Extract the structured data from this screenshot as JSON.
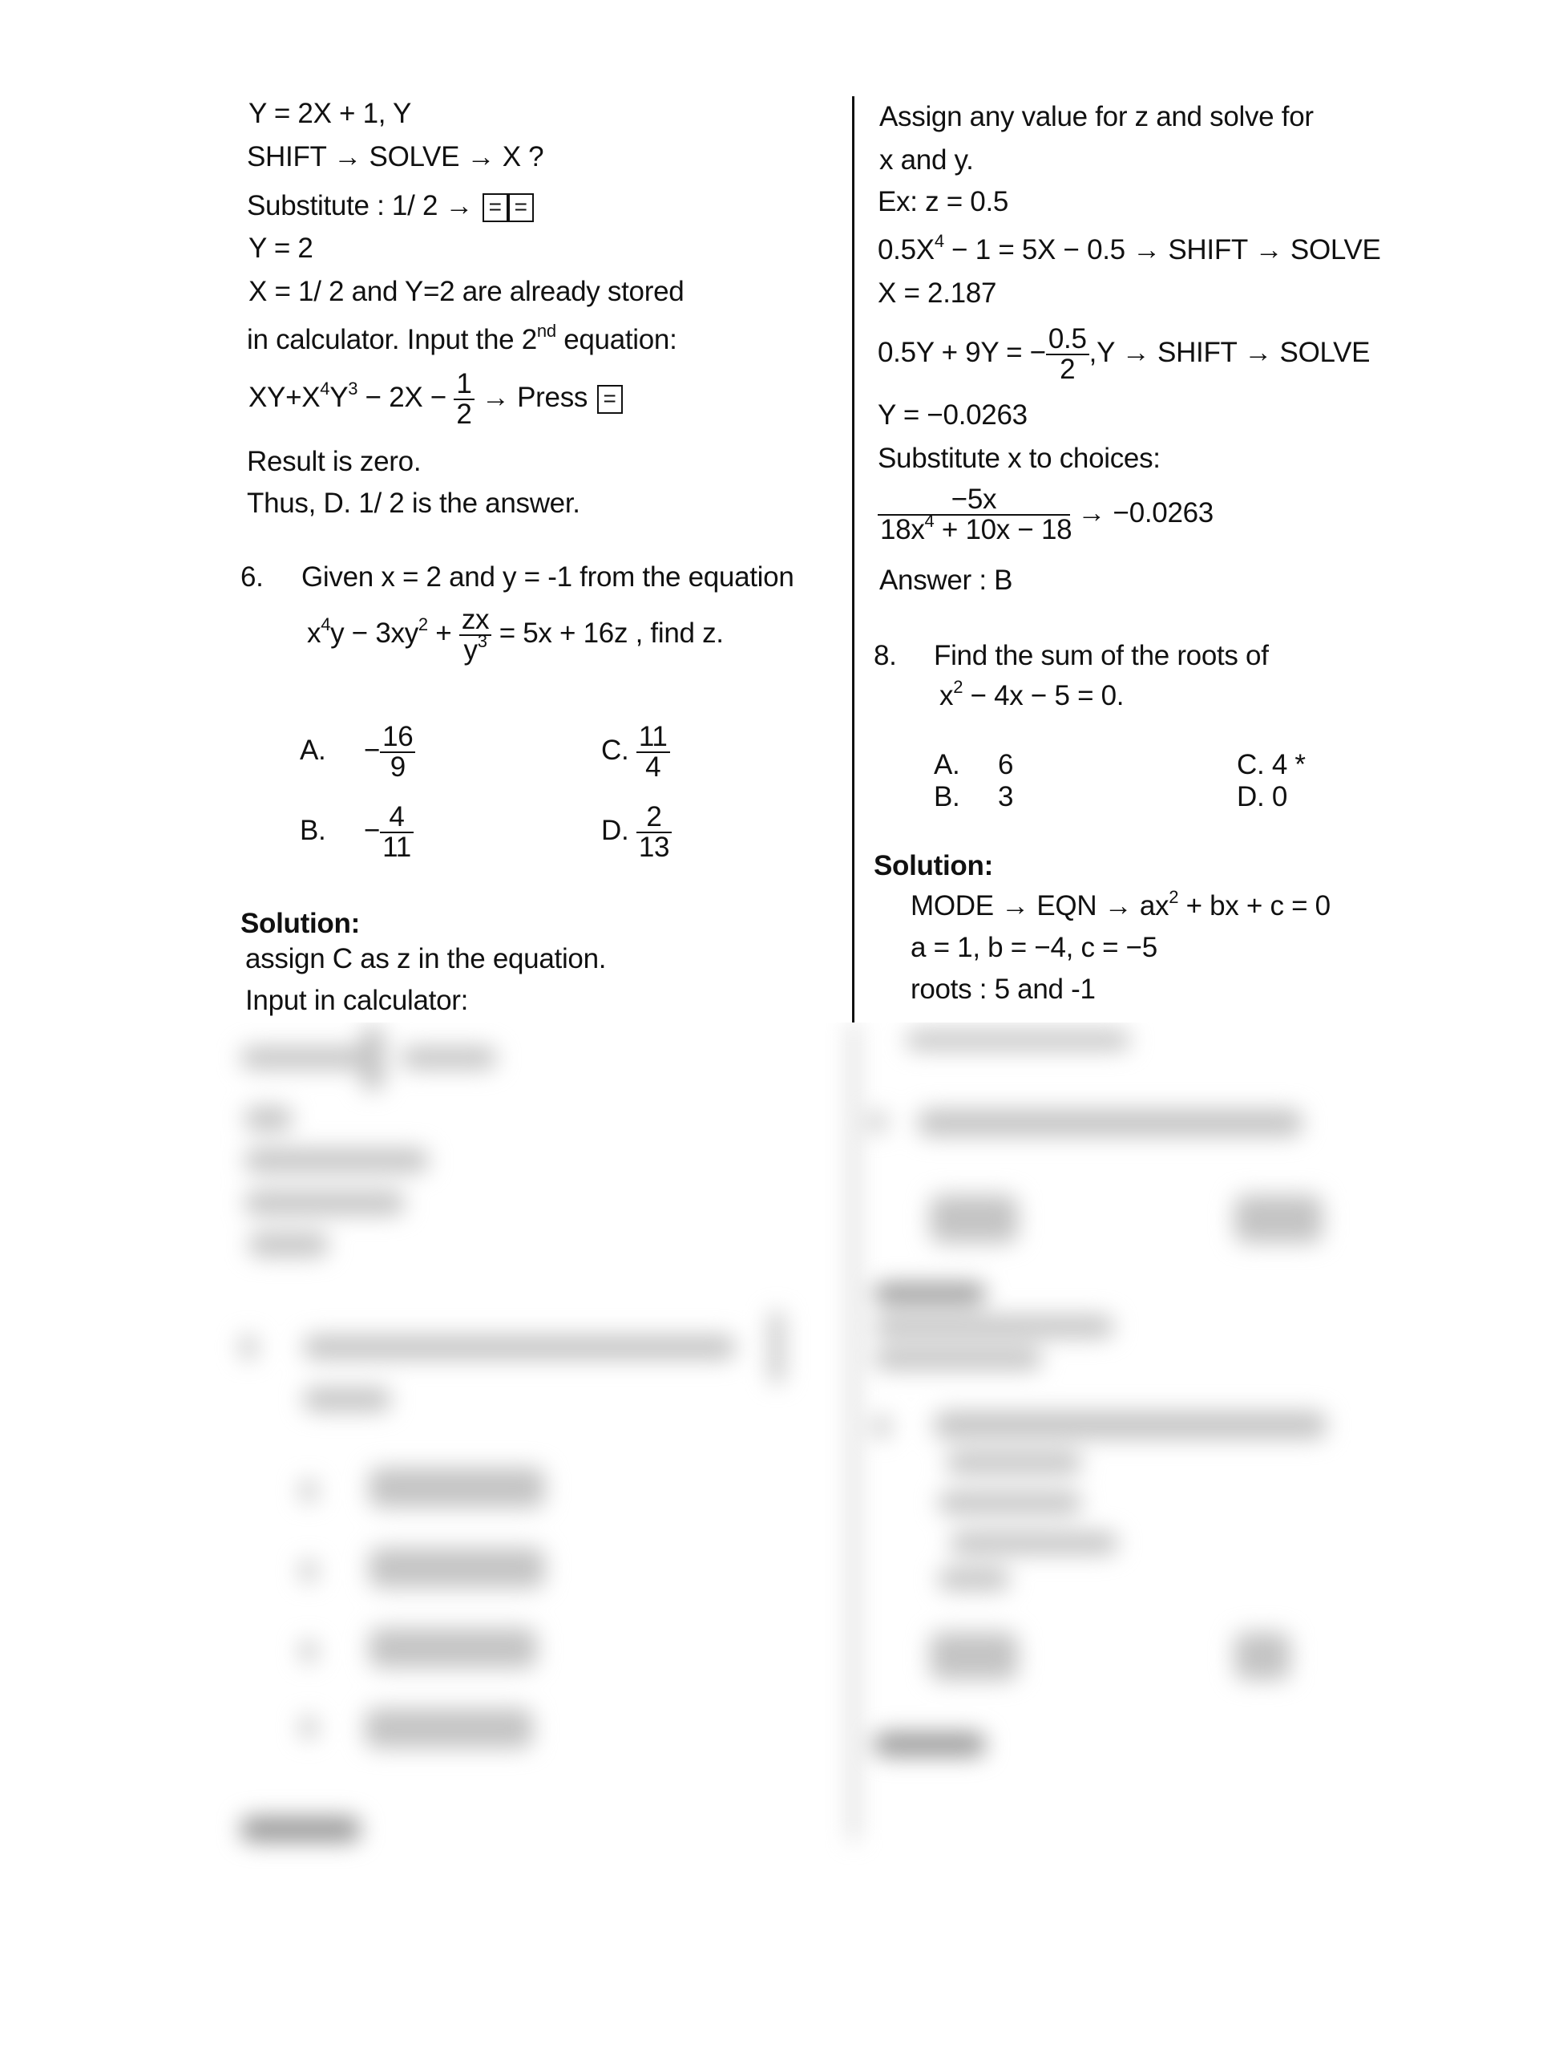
{
  "left_column": {
    "lines": [
      "Y = 2X + 1, Y",
      "SHIFT → SOLVE → X ?",
      "Substitute : 1/ 2 →",
      "Y = 2",
      "X = 1/ 2 and Y=2 are already stored",
      "in calculator. Input the 2",
      "equation:"
    ],
    "second_sup": "nd",
    "key_equals": "=",
    "equation2": {
      "prefix": "XY+X",
      "sup1": "4",
      "mid": "Y",
      "sup2": "3",
      "rest": " − 2X −",
      "frac_num": "1",
      "frac_den": "2",
      "suffix": "→ Press"
    },
    "result_line": "Result is zero.",
    "thus_line": "Thus, D. 1/ 2 is the answer.",
    "question6": {
      "number": "6.",
      "text": "Given x = 2 and y = -1 from the equation",
      "eq_x": "x",
      "eq_sup4": "4",
      "eq_part1": "y − 3xy",
      "eq_sup2": "2",
      "eq_plus": " +",
      "eq_frac_num": "zx",
      "eq_frac_den_base": "y",
      "eq_frac_den_sup": "3",
      "eq_part2": "= 5x + 16z , find z.",
      "options": [
        {
          "label": "A.",
          "sign": "−",
          "num": "16",
          "den": "9"
        },
        {
          "label": "B.",
          "sign": "−",
          "num": "4",
          "den": "11"
        },
        {
          "label": "C.",
          "sign": "",
          "num": "11",
          "den": "4"
        },
        {
          "label": "D.",
          "sign": "",
          "num": "2",
          "den": "13"
        }
      ]
    },
    "solution_heading": "Solution:",
    "solution_lines": [
      "assign C as z in the equation.",
      "Input in calculator:"
    ]
  },
  "right_column": {
    "lines": [
      "Assign any value for z and solve for",
      "x and y.",
      "Ex: z = 0.5"
    ],
    "eq_x": {
      "part1": "0.5X",
      "sup": "4",
      "part2": " − 1 = 5X − 0.5 → SHIFT → SOLVE"
    },
    "x_value": "X = 2.187",
    "eq_y": {
      "part1": "0.5Y + 9Y = −",
      "frac_num": "0.5",
      "frac_den": "2",
      "part2": ",Y → SHIFT → SOLVE"
    },
    "y_value": "Y = −0.0263",
    "substitute_line": "Substitute x to choices:",
    "choice_frac": {
      "num": "−5x",
      "den_part1": "18x",
      "den_sup": "4",
      "den_part2": " + 10x − 18",
      "result": "→ −0.0263"
    },
    "answer_line": "Answer : B",
    "question8": {
      "number": "8.",
      "text": "Find the sum of the roots of",
      "eq_x": "x",
      "eq_sup": "2",
      "eq_rest": " − 4x − 5 = 0.",
      "options": [
        {
          "label": "A.",
          "value": "6"
        },
        {
          "label": "B.",
          "value": "3"
        },
        {
          "label": "C.",
          "value": "4 *"
        },
        {
          "label": "D.",
          "value": "0"
        }
      ]
    },
    "solution_heading": "Solution:",
    "solution": {
      "mode_line_part1": "MODE → EQN → ax",
      "mode_line_sup": "2",
      "mode_line_part2": " + bx + c = 0",
      "coeffs": "a = 1,  b = −4,  c = −5",
      "roots": "roots : 5 and -1"
    }
  },
  "blurred_preview": {
    "note": "",
    "question_numbers_visible": [
      "7.",
      "9.",
      "10."
    ]
  }
}
